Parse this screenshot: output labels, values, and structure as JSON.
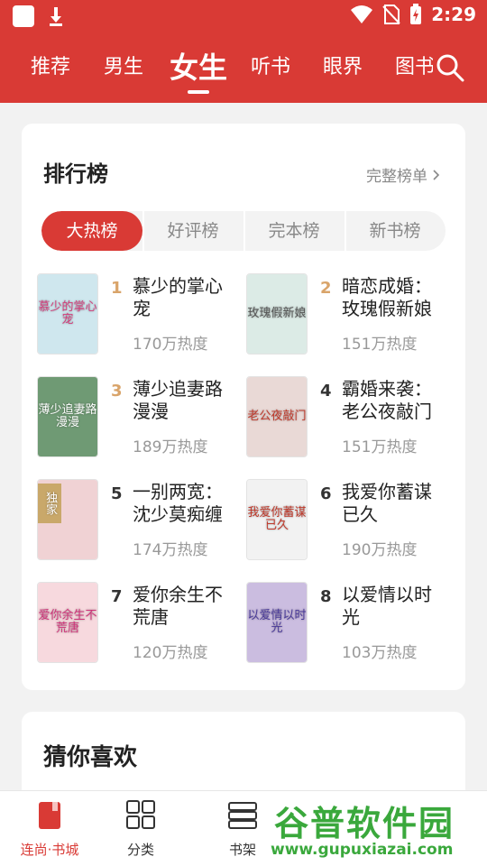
{
  "status_bar": {
    "time": "2:29"
  },
  "top_nav": {
    "tabs": [
      {
        "label": "推荐"
      },
      {
        "label": "男生"
      },
      {
        "label": "女生",
        "active": true
      },
      {
        "label": "听书"
      },
      {
        "label": "眼界"
      },
      {
        "label": "图书"
      }
    ]
  },
  "ranking": {
    "title": "排行榜",
    "full_list_label": "完整榜单",
    "segments": [
      {
        "label": "大热榜",
        "active": true
      },
      {
        "label": "好评榜"
      },
      {
        "label": "完本榜"
      },
      {
        "label": "新书榜"
      }
    ],
    "books": [
      {
        "rank": "1",
        "title": "慕少的掌心宠",
        "heat": "170万热度",
        "cover_text": "慕少的掌心宠",
        "cover_color": "#cfe7ee"
      },
      {
        "rank": "2",
        "title": "暗恋成婚：玫瑰假新娘",
        "heat": "151万热度",
        "cover_text": "玫瑰假新娘",
        "cover_color": "#dcebe6"
      },
      {
        "rank": "3",
        "title": "薄少追妻路漫漫",
        "heat": "189万热度",
        "cover_text": "薄少追妻路漫漫",
        "cover_color": "#6f9a74"
      },
      {
        "rank": "4",
        "title": "霸婚来袭：老公夜敲门",
        "heat": "151万热度",
        "cover_text": "老公夜敲门",
        "cover_color": "#e9d9d6"
      },
      {
        "rank": "5",
        "title": "一别两宽：沈少莫痴缠",
        "heat": "174万热度",
        "cover_text": "独家",
        "cover_color": "#f0d2d4"
      },
      {
        "rank": "6",
        "title": "我爱你蓄谋已久",
        "heat": "190万热度",
        "cover_text": "我爱你蓄谋已久",
        "cover_color": "#f2f2f2"
      },
      {
        "rank": "7",
        "title": "爱你余生不荒唐",
        "heat": "120万热度",
        "cover_text": "爱你余生不荒唐",
        "cover_color": "#f7d9de"
      },
      {
        "rank": "8",
        "title": "以爱情以时光",
        "heat": "103万热度",
        "cover_text": "以爱情以时光",
        "cover_color": "#cbbde0"
      }
    ]
  },
  "guess": {
    "title": "猜你喜欢"
  },
  "bottom_nav": {
    "items": [
      {
        "label": "连尚·书城",
        "icon": "book-icon",
        "active": true
      },
      {
        "label": "分类",
        "icon": "grid-icon"
      },
      {
        "label": "书架",
        "icon": "shelf-icon"
      }
    ]
  },
  "watermark": {
    "text": "谷普软件园",
    "url": "www.gupuxiazai.com"
  },
  "colors": {
    "accent": "#d93a35",
    "top3_rank": "#d9a46a",
    "watermark": "#3aa83c"
  }
}
